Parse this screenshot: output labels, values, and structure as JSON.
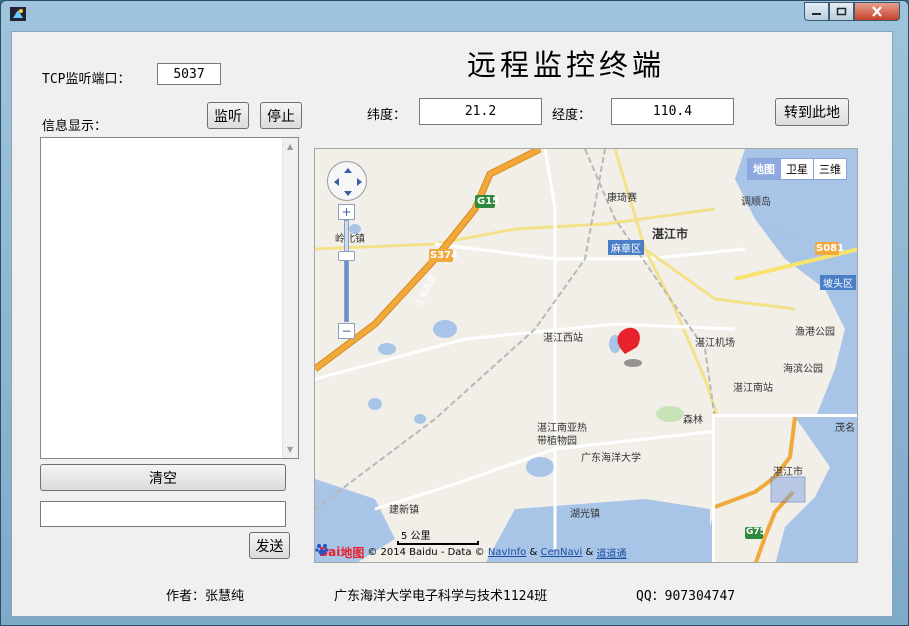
{
  "window": {
    "title": ""
  },
  "labels": {
    "port": "TCP监听端口：",
    "info": "信息显示：",
    "lat": "纬度：",
    "lng": "经度："
  },
  "values": {
    "port": "5037",
    "lat": "21.2",
    "lng": "110.4",
    "send_text": ""
  },
  "buttons": {
    "listen": "监听",
    "stop": "停止",
    "goto": "转到此地",
    "clear": "清空",
    "send": "发送"
  },
  "title": "远程监控终端",
  "map": {
    "type_buttons": [
      "地图",
      "卫星",
      "三维"
    ],
    "places": {
      "kangqisai": "康琦赛",
      "tiaoshun": "调顺岛",
      "zhanjiang": "湛江市",
      "mazhang": "麻章区",
      "lingbei": "岭北镇",
      "potou": "坡头区",
      "xizhan": "湛江西站",
      "jichang": "湛江机场",
      "yugang": "渔港公园",
      "haibin": "海滨公园",
      "nanzhan": "湛江南站",
      "senlin": "森林",
      "botanic1": "湛江南亚热",
      "botanic2": "带植物园",
      "gdou": "广东海洋大学",
      "jianxin": "建新镇",
      "huguang": "湖光镇",
      "maoming": "茂名",
      "ov_city": "湛江市"
    },
    "roads": {
      "g15": "G15",
      "s374": "S374",
      "s081": "S081",
      "g75": "G75",
      "expressway": "沈海高速"
    },
    "scale": "5 公里",
    "logo": "Baidu地图",
    "copyright_prefix": "© 2014 Baidu - Data ©",
    "copyright_links": [
      "NavInfo",
      "CenNavi",
      "道道通"
    ],
    "amp": "&"
  },
  "footer": {
    "author": "作者：张慧纯",
    "school": "广东海洋大学电子科学与技术1124班",
    "qq": "QQ：907304747"
  },
  "colors": {
    "marker": "#e8222b",
    "water": "#a8c4e6",
    "highway": "#f0a93a",
    "road": "#f7e36e"
  }
}
